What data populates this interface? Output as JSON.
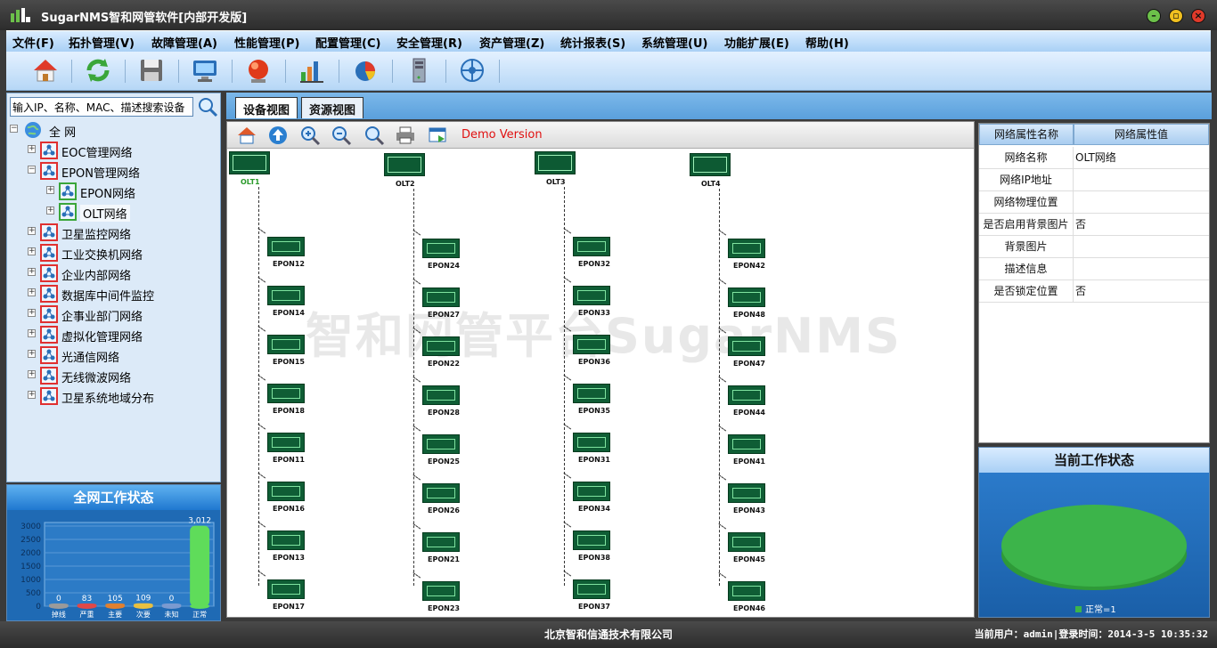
{
  "app": {
    "title": "SugarNMS智和网管软件[内部开发版]",
    "colors": {
      "accent": "#1f78d0",
      "device_green": "#0f5d35",
      "demo_red": "#e01010",
      "pie_green": "#3cb44a"
    }
  },
  "menu": [
    "文件(F)",
    "拓扑管理(V)",
    "故障管理(A)",
    "性能管理(P)",
    "配置管理(C)",
    "安全管理(R)",
    "资产管理(Z)",
    "统计报表(S)",
    "系统管理(U)",
    "功能扩展(E)",
    "帮助(H)"
  ],
  "toolbar_icons": [
    "home-icon",
    "refresh-icon",
    "save-icon",
    "monitor-icon",
    "alarm-icon",
    "bar-chart-icon",
    "pie-chart-icon",
    "server-icon",
    "network-icon"
  ],
  "search": {
    "placeholder": "输入IP、名称、MAC、描述搜索设备",
    "value": "输入IP、名称、MAC、描述搜索设备"
  },
  "tree": {
    "root": "全  网",
    "items": [
      {
        "label": "EOC管理网络",
        "level": 1,
        "expanded": false
      },
      {
        "label": "EPON管理网络",
        "level": 1,
        "expanded": true
      },
      {
        "label": "EPON网络",
        "level": 2,
        "expanded": false
      },
      {
        "label": "OLT网络",
        "level": 2,
        "expanded": false,
        "selected": true
      },
      {
        "label": "卫星监控网络",
        "level": 1,
        "expanded": false
      },
      {
        "label": "工业交换机网络",
        "level": 1,
        "expanded": false
      },
      {
        "label": "企业内部网络",
        "level": 1,
        "expanded": false
      },
      {
        "label": "数据库中间件监控",
        "level": 1,
        "expanded": false
      },
      {
        "label": "企事业部门网络",
        "level": 1,
        "expanded": false
      },
      {
        "label": "虚拟化管理网络",
        "level": 1,
        "expanded": false
      },
      {
        "label": "光通信网络",
        "level": 1,
        "expanded": false
      },
      {
        "label": "无线微波网络",
        "level": 1,
        "expanded": false
      },
      {
        "label": "卫星系统地域分布",
        "level": 1,
        "expanded": false
      }
    ]
  },
  "left_status": {
    "title": "全网工作状态"
  },
  "chart_data": {
    "type": "bar",
    "categories": [
      "掉线",
      "严重",
      "主要",
      "次要",
      "未知",
      "正常"
    ],
    "values": [
      0,
      83,
      105,
      109,
      0,
      3012
    ],
    "value_labels": [
      "0",
      "83",
      "105",
      "109",
      "0",
      "3,012"
    ],
    "yticks": [
      "0",
      "500",
      "1000",
      "1500",
      "2000",
      "2500",
      "3000"
    ],
    "ylim": [
      0,
      3000
    ],
    "colors": [
      "#9a9a9a",
      "#e04848",
      "#e08030",
      "#e8c040",
      "#7a9ad0",
      "#5fdc5a"
    ]
  },
  "tabs": [
    {
      "label": "设备视图",
      "active": true
    },
    {
      "label": "资源视图",
      "active": false
    }
  ],
  "view_toolbar": {
    "icons": [
      "home-icon",
      "up-icon",
      "zoom-in-icon",
      "zoom-out-icon",
      "zoom-fit-icon",
      "print-icon",
      "export-icon"
    ],
    "demo": "Demo Version"
  },
  "watermark": "智和网管平台SugarNMS",
  "topology": {
    "olts": [
      {
        "name": "OLT1",
        "highlight": true,
        "children": [
          "EPON12",
          "EPON14",
          "EPON15",
          "EPON18",
          "EPON11",
          "EPON16",
          "EPON13",
          "EPON17"
        ]
      },
      {
        "name": "OLT2",
        "highlight": false,
        "children": [
          "EPON24",
          "EPON27",
          "EPON22",
          "EPON28",
          "EPON25",
          "EPON26",
          "EPON21",
          "EPON23"
        ]
      },
      {
        "name": "OLT3",
        "highlight": false,
        "children": [
          "EPON32",
          "EPON33",
          "EPON36",
          "EPON35",
          "EPON31",
          "EPON34",
          "EPON38",
          "EPON37"
        ]
      },
      {
        "name": "OLT4",
        "highlight": false,
        "children": [
          "EPON42",
          "EPON48",
          "EPON47",
          "EPON44",
          "EPON41",
          "EPON43",
          "EPON45",
          "EPON46"
        ]
      }
    ]
  },
  "properties": {
    "headers": [
      "网络属性名称",
      "网络属性值"
    ],
    "rows": [
      {
        "name": "网络名称",
        "value": "OLT网络"
      },
      {
        "name": "网络IP地址",
        "value": ""
      },
      {
        "name": "网络物理位置",
        "value": ""
      },
      {
        "name": "是否启用背景图片",
        "value": "否"
      },
      {
        "name": "背景图片",
        "value": ""
      },
      {
        "name": "描述信息",
        "value": ""
      },
      {
        "name": "是否锁定位置",
        "value": "否"
      }
    ]
  },
  "right_status": {
    "title": "当前工作状态",
    "legend": "正常=1"
  },
  "footer": {
    "company": "北京智和信通技术有限公司",
    "login": "当前用户：admin|登录时间：2014-3-5 10:35:32"
  }
}
